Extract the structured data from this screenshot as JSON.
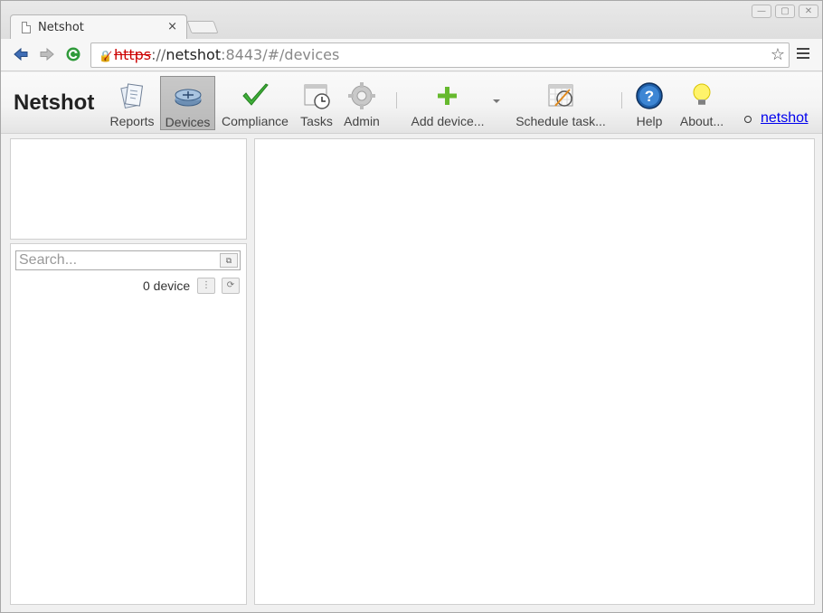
{
  "browser": {
    "tab_title": "Netshot",
    "tab_close": "×",
    "url": {
      "scheme": "https",
      "separator": "://",
      "host": "netshot",
      "path": ":8443/#/devices"
    }
  },
  "app": {
    "brand": "Netshot",
    "nav": [
      {
        "label": "Reports"
      },
      {
        "label": "Devices"
      },
      {
        "label": "Compliance"
      },
      {
        "label": "Tasks"
      },
      {
        "label": "Admin"
      },
      {
        "label": "Add device..."
      },
      {
        "label": "Schedule task..."
      },
      {
        "label": "Help"
      },
      {
        "label": "About..."
      }
    ],
    "user": "netshot",
    "active_nav": "Devices"
  },
  "sidebar": {
    "search_placeholder": "Search...",
    "device_count": "0 device"
  },
  "colors": {
    "accent_link": "#0000ee",
    "active_nav_bg": "#bdbdbd",
    "insecure": "#cc0000"
  },
  "icons": {
    "reports": "reports-icon",
    "devices": "devices-icon",
    "compliance": "checkmark-icon",
    "tasks": "clock-icon",
    "admin": "gear-icon",
    "add_device": "plus-icon",
    "schedule": "calendar-icon",
    "help": "help-icon",
    "about": "lightbulb-icon"
  }
}
